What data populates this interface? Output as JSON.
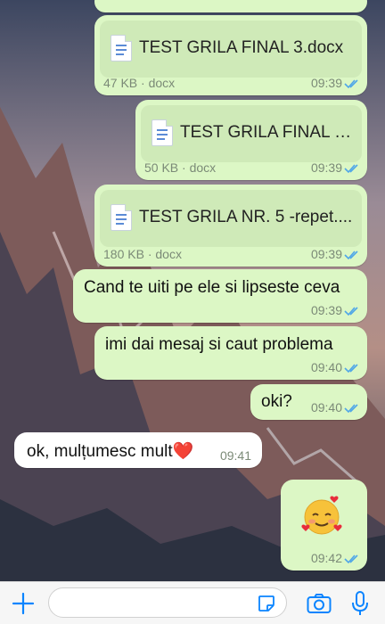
{
  "messages": [
    {
      "type": "file",
      "name": "TEST GRILA FINAL 3.docx",
      "size": "47 KB · docx",
      "time": "09:39"
    },
    {
      "type": "file",
      "name": "TEST GRILA FINAL 3...",
      "size": "50 KB · docx",
      "time": "09:39"
    },
    {
      "type": "file",
      "name": "TEST GRILA NR. 5 -repet....",
      "size": "180 KB · docx",
      "time": "09:39"
    },
    {
      "type": "text",
      "text": "Cand te uiti pe ele si lipseste ceva",
      "time": "09:39"
    },
    {
      "type": "text",
      "text": "imi dai mesaj si caut problema",
      "time": "09:40"
    },
    {
      "type": "text",
      "text": "oki?",
      "time": "09:40"
    },
    {
      "type": "incoming",
      "text": "ok, mulțumesc mult❤️",
      "time": "09:41"
    },
    {
      "type": "emoji",
      "emoji_name": "smiling-face-with-hearts",
      "time": "09:42"
    }
  ],
  "input": {
    "placeholder": ""
  },
  "icons": {
    "plus": "plus-icon",
    "sticker": "sticker-icon",
    "camera": "camera-icon",
    "mic": "microphone-icon",
    "read_receipt": "double-check-icon"
  },
  "colors": {
    "outgoing_bubble": "#dcf7c5",
    "incoming_bubble": "#ffffff",
    "accent": "#0a84ff",
    "ticks": "#4fa6e8"
  }
}
